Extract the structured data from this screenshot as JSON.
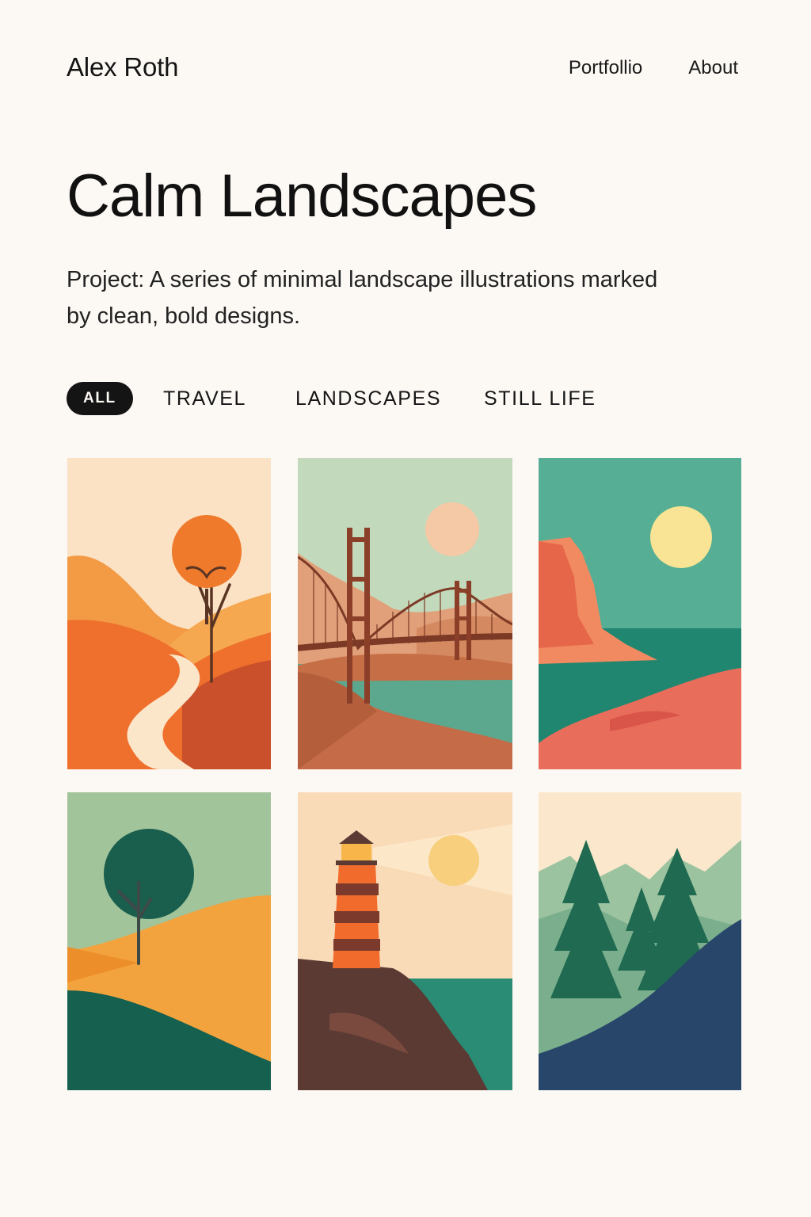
{
  "header": {
    "brand": "Alex Roth",
    "nav": [
      "Portfollio",
      "About"
    ]
  },
  "hero": {
    "title": "Calm Landscapes",
    "description": "Project: A series of minimal landscape illustrations marked by clean, bold designs."
  },
  "filters": {
    "items": [
      "ALL",
      "TRAVEL",
      "LANDSCAPES",
      "STILL LIFE"
    ],
    "active": "ALL"
  },
  "gallery": {
    "items": [
      {
        "subject": "orange hills with a winding path and a lone tree"
      },
      {
        "subject": "suspension bridge over a bay with a pale sun"
      },
      {
        "subject": "red sea cliffs beside a teal ocean under a yellow sun"
      },
      {
        "subject": "green and amber hills with a round dark-green tree"
      },
      {
        "subject": "striped lighthouse on a rocky cliff at sunset"
      },
      {
        "subject": "pine forest in front of misty mountains"
      }
    ]
  },
  "colors": {
    "background": "#fcf9f5",
    "text": "#141414",
    "active_pill": "#141414",
    "orange": "#ef7a2c",
    "teal": "#1f8a72",
    "sage": "#a1c49a",
    "cream": "#fce3c4",
    "navy": "#27466a"
  }
}
